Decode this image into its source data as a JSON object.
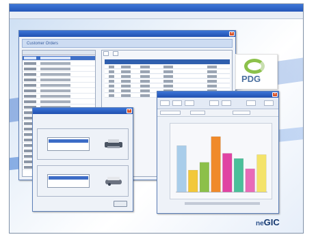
{
  "app": {
    "title": ""
  },
  "menubar": {
    "items": [
      "",
      "",
      "",
      "",
      ""
    ]
  },
  "customer_window": {
    "title": "",
    "header": "Customer Orders",
    "orders_tabs": [
      "",
      ""
    ]
  },
  "dialog_window": {
    "title": "",
    "button": ""
  },
  "chart_window": {
    "title": ""
  },
  "badge": {
    "text": "PDG"
  },
  "logo": {
    "prefix": "ne",
    "main": "GIC"
  },
  "colors": {
    "titlebar": "#2456b8",
    "selection": "#3e6fc7",
    "badge_swoosh": "#8cc14b"
  },
  "chart_data": {
    "type": "bar",
    "categories": [
      "",
      "",
      "",
      "",
      "",
      "",
      "",
      ""
    ],
    "series": [
      {
        "values": [
          72,
          34,
          46,
          86,
          60,
          52,
          36,
          58
        ]
      }
    ],
    "colors": [
      "#a9cdea",
      "#f2c83a",
      "#8cc04a",
      "#f08a2a",
      "#e043a3",
      "#4bbf9a",
      "#e86ab8",
      "#f4e36a"
    ],
    "ylim": [
      0,
      100
    ]
  }
}
